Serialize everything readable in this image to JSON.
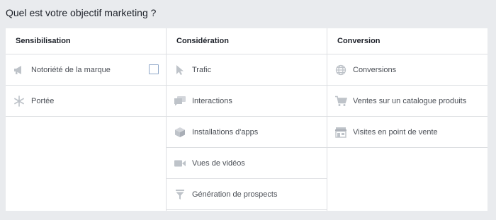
{
  "heading": "Quel est votre objectif marketing ?",
  "columns": [
    {
      "title": "Sensibilisation",
      "items": [
        {
          "label": "Notoriété de la marque",
          "icon": "megaphone-icon"
        },
        {
          "label": "Portée",
          "icon": "snowflake-icon"
        }
      ]
    },
    {
      "title": "Considération",
      "items": [
        {
          "label": "Trafic",
          "icon": "cursor-icon"
        },
        {
          "label": "Interactions",
          "icon": "chat-bubbles-icon"
        },
        {
          "label": "Installations d'apps",
          "icon": "cube-icon"
        },
        {
          "label": "Vues de vidéos",
          "icon": "video-camera-icon"
        },
        {
          "label": "Génération de prospects",
          "icon": "funnel-icon"
        }
      ]
    },
    {
      "title": "Conversion",
      "items": [
        {
          "label": "Conversions",
          "icon": "globe-icon"
        },
        {
          "label": "Ventes sur un catalogue produits",
          "icon": "shopping-cart-icon"
        },
        {
          "label": "Visites en point de vente",
          "icon": "storefront-icon"
        }
      ]
    }
  ],
  "colors": {
    "icon": "#bec3c9",
    "checkbox_border": "#8fa7c9",
    "divider": "#dddfe2",
    "background": "#e9ebee"
  }
}
